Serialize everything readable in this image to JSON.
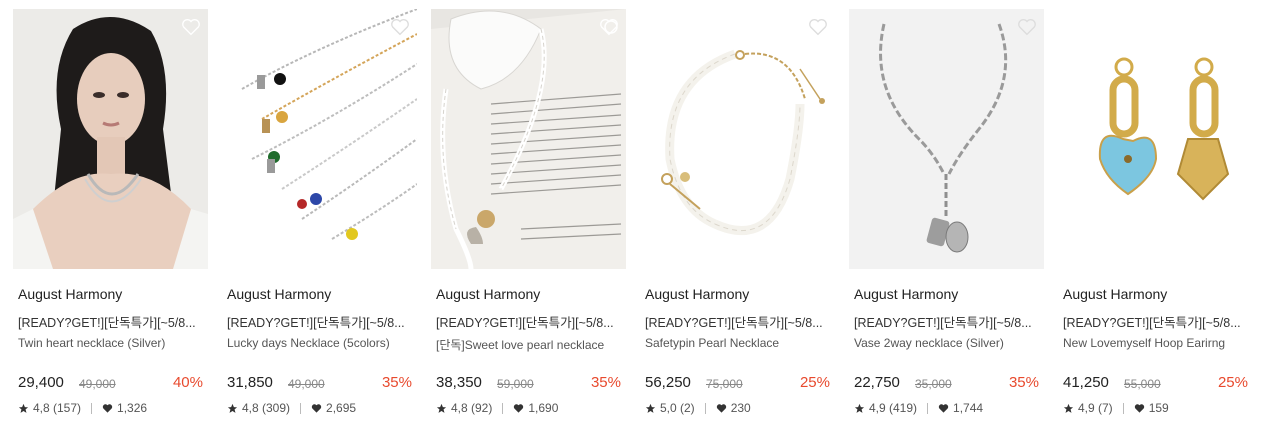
{
  "products": [
    {
      "brand": "August Harmony",
      "title": "[READY?GET!][단독특가][~5/8...",
      "subtitle": "Twin heart necklace (Silver)",
      "price": "29,400",
      "original_price": "49,000",
      "discount": "40%",
      "rating": "4,8 (157)",
      "likes": "1,326",
      "image": "model-portrait-necklace"
    },
    {
      "brand": "August Harmony",
      "title": "[READY?GET!][단독특가][~5/8...",
      "subtitle": "Lucky days Necklace (5colors)",
      "price": "31,850",
      "original_price": "49,000",
      "discount": "35%",
      "rating": "4,8 (309)",
      "likes": "2,695",
      "image": "five-charm-necklaces"
    },
    {
      "brand": "August Harmony",
      "title": "[READY?GET!][단독특가][~5/8...",
      "subtitle": "[단독]Sweet love pearl necklace",
      "price": "38,350",
      "original_price": "59,000",
      "discount": "35%",
      "rating": "4,8 (92)",
      "likes": "1,690",
      "image": "pearl-necklace-on-book"
    },
    {
      "brand": "August Harmony",
      "title": "[READY?GET!][단독특가][~5/8...",
      "subtitle": "Safetypin Pearl Necklace",
      "price": "56,250",
      "original_price": "75,000",
      "discount": "25%",
      "rating": "5,0 (2)",
      "likes": "230",
      "image": "safetypin-pearl-necklace"
    },
    {
      "brand": "August Harmony",
      "title": "[READY?GET!][단독특가][~5/8...",
      "subtitle": "Vase 2way necklace (Silver)",
      "price": "22,750",
      "original_price": "35,000",
      "discount": "35%",
      "rating": "4,9 (419)",
      "likes": "1,744",
      "image": "silver-chain-lariat"
    },
    {
      "brand": "August Harmony",
      "title": "[READY?GET!][단독특가][~5/8...",
      "subtitle": "New Lovemyself Hoop Earirng",
      "price": "41,250",
      "original_price": "55,000",
      "discount": "25%",
      "rating": "4,9 (7)",
      "likes": "159",
      "image": "heart-hoop-earrings"
    }
  ],
  "colors": {
    "discount": "#e84a2e",
    "text": "#222222",
    "muted": "#888888"
  },
  "icons": {
    "wishlist": "heart-outline-icon",
    "rating": "star-icon",
    "likes": "heart-filled-icon"
  }
}
